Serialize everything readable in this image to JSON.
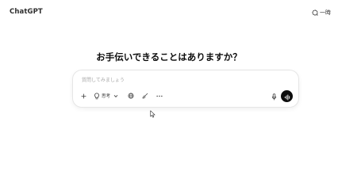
{
  "header": {
    "brand": "ChatGPT",
    "temporary_chat_label": "一時",
    "temporary_chat_icon": "chat-bubble-dashed-icon"
  },
  "main": {
    "headline": "お手伝いできることはありますか？"
  },
  "composer": {
    "placeholder": "質問してみましょう",
    "tools": {
      "add_icon": "plus-icon",
      "think_icon": "lightbulb-icon",
      "think_label": "思考",
      "think_chevron_icon": "chevron-down-icon",
      "web_search_icon": "globe-icon",
      "image_icon": "brush-icon",
      "more_icon": "ellipsis-icon"
    },
    "mic_icon": "microphone-icon",
    "voice_icon": "voice-waveform-icon"
  },
  "colors": {
    "background": "#ffffff",
    "text": "#0d0d0d",
    "placeholder": "#a8a8a8",
    "voice_button": "#0d0d0d",
    "border": "#e6e6e6"
  }
}
